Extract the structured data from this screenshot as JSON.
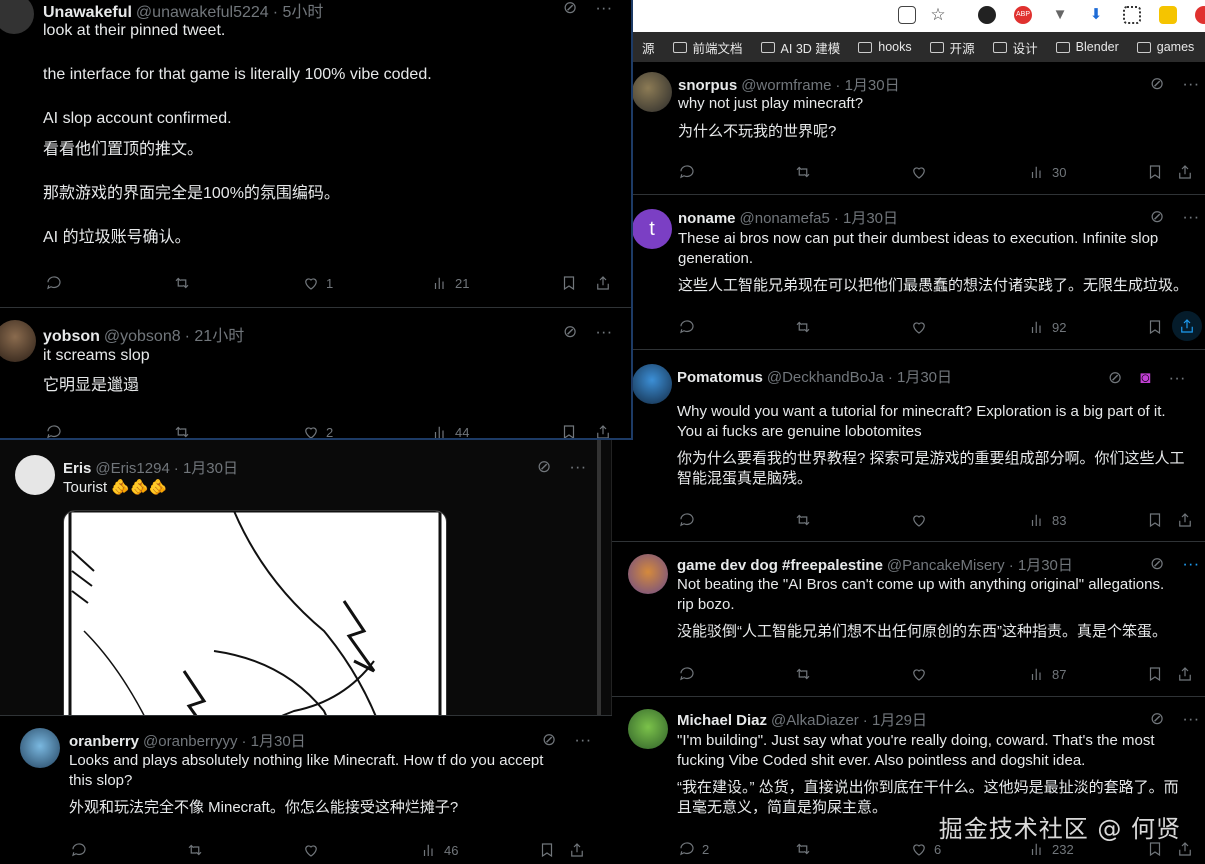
{
  "bookmarks": [
    "源",
    "前端文档",
    "AI 3D 建模",
    "hooks",
    "开源",
    "设计",
    "Blender",
    "games"
  ],
  "tweets_tl": [
    {
      "name": "Unawakeful",
      "handle": "@unawakeful5224",
      "time": "· 5小时",
      "lines": [
        "look at their pinned tweet.",
        "the interface for that game is literally 100% vibe coded.",
        "AI slop account confirmed.",
        "看看他们置顶的推文。",
        "那款游戏的界面完全是100%的氛围编码。",
        "AI 的垃圾账号确认。"
      ],
      "likes": "1",
      "views": "21"
    },
    {
      "name": "yobson",
      "handle": "@yobson8",
      "time": "· 21小时",
      "lines": [
        "it screams slop",
        "它明显是邋遢"
      ],
      "likes": "2",
      "views": "44"
    }
  ],
  "tweets_bl": [
    {
      "name": "Eris",
      "handle": "@Eris1294",
      "time": "· 1月30日",
      "lines": [
        "Tourist 🫵🫵🫵"
      ]
    },
    {
      "name": "oranberry",
      "handle": "@oranberryyy",
      "time": "· 1月30日",
      "lines": [
        "Looks and plays absolutely nothing like Minecraft. How tf do you accept",
        "this slop?",
        "外观和玩法完全不像 Minecraft。你怎么能接受这种烂摊子?"
      ],
      "views": "46"
    }
  ],
  "tweets_right": [
    {
      "name": "snorpus",
      "handle": "@wormframe",
      "time": "· 1月30日",
      "lines": [
        "why not just play minecraft?",
        "为什么不玩我的世界呢?"
      ],
      "views": "30"
    },
    {
      "name": "noname",
      "handle": "@nonamefa5",
      "time": "· 1月30日",
      "avatar_letter": "t",
      "lines": [
        "These ai bros now can put their dumbest ideas to execution. Infinite slop",
        "generation.",
        "这些人工智能兄弟现在可以把他们最愚蠢的想法付诸实践了。无限生成垃圾。"
      ],
      "views": "92"
    },
    {
      "name": "Pomatomus",
      "handle": "@DeckhandBoJa",
      "time": "· 1月30日",
      "lines": [
        "Why would you want a tutorial for minecraft? Exploration is a big part of it.",
        "You ai fucks are genuine lobotomites",
        "你为什么要看我的世界教程? 探索可是游戏的重要组成部分啊。你们这些人工",
        "智能混蛋真是脑残。"
      ],
      "views": "83"
    },
    {
      "name": "game dev dog #freepalestine",
      "handle": "@PancakeMisery",
      "time": "· 1月30日",
      "lines": [
        "Not beating the \"AI Bros can't come up with anything original\" allegations.",
        "rip bozo.",
        "没能驳倒“人工智能兄弟们想不出任何原创的东西”这种指责。真是个笨蛋。"
      ],
      "views": "87"
    },
    {
      "name": "Michael Diaz",
      "handle": "@AlkaDiazer",
      "time": "· 1月29日",
      "lines": [
        "\"I'm building\". Just say what you're really doing, coward. That's the most",
        "fucking Vibe Coded shit ever. Also pointless and dogshit idea.",
        "“我在建设。” 怂货，直接说出你到底在干什么。这他妈是最扯淡的套路了。而",
        "且毫无意义，简直是狗屎主意。"
      ],
      "replies": "2",
      "likes": "6",
      "views": "232"
    }
  ],
  "watermark": "掘金技术社区 @ 何贤",
  "colors": {
    "bg": "#000000",
    "text": "#e7e9ea",
    "muted": "#71767b",
    "divider": "#2f3336",
    "accent": "#1d9bf0"
  }
}
